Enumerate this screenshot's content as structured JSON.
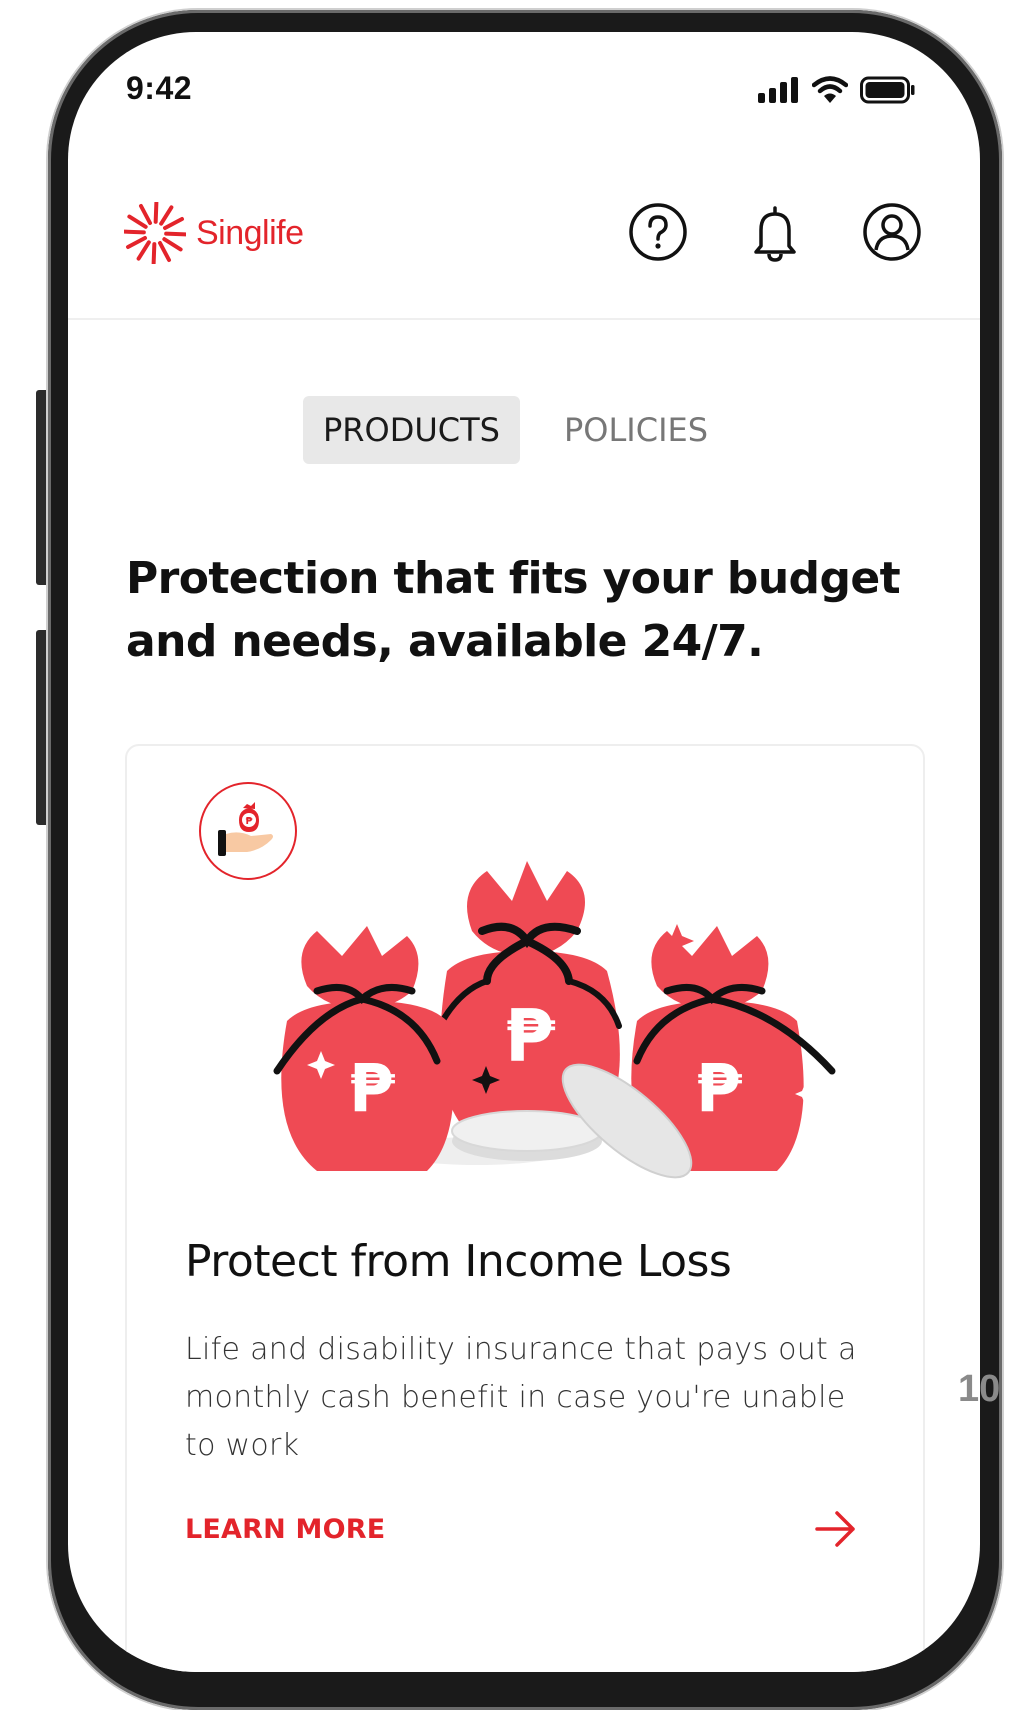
{
  "status_bar": {
    "time": "9:42",
    "signal_icon": "signal-bars-icon",
    "wifi_icon": "wifi-icon",
    "battery_icon": "battery-icon"
  },
  "header": {
    "brand": "Singlife",
    "brand_color": "#e3242b",
    "icons": [
      "help-circle-icon",
      "bell-icon",
      "user-profile-icon"
    ]
  },
  "tabs": [
    {
      "label": "PRODUCTS",
      "active": true
    },
    {
      "label": "POLICIES",
      "active": false
    }
  ],
  "headline": "Protection that fits your budget and needs, available 24/7.",
  "card": {
    "badge_icon": "hand-money-bag-icon",
    "illustration": "money-bags-illustration",
    "currency_symbol": "₱",
    "title": "Protect from Income Loss",
    "description": "Life and disability insurance that pays out a monthly cash benefit in case you're unable to work",
    "cta_label": "LEARN MORE",
    "cta_icon": "arrow-right-icon"
  },
  "page_number": "10"
}
